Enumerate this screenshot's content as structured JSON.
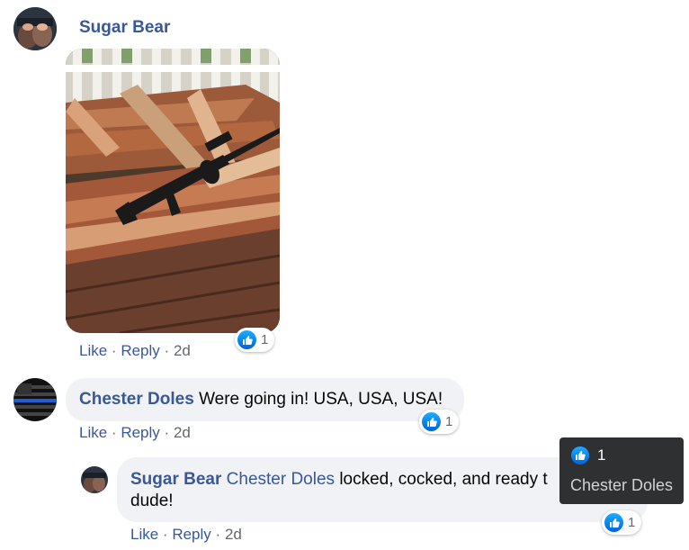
{
  "comments": [
    {
      "author": "Sugar Bear",
      "text": "",
      "has_photo": true,
      "actions": {
        "like": "Like",
        "reply": "Reply",
        "time": "2d",
        "sep": "·"
      },
      "reaction_count": "1"
    },
    {
      "author": "Chester Doles",
      "text": "Were going in! USA, USA, USA!",
      "actions": {
        "like": "Like",
        "reply": "Reply",
        "time": "2d",
        "sep": "·"
      },
      "reaction_count": "1"
    }
  ],
  "reply": {
    "author": "Sugar Bear",
    "mention": "Chester Doles",
    "text_line1": "locked, cocked, and ready t",
    "text_line2": "dude!",
    "actions": {
      "like": "Like",
      "reply": "Reply",
      "time": "2d",
      "sep": "·"
    },
    "reaction_count": "1"
  },
  "tooltip": {
    "count": "1",
    "name": "Chester Doles"
  },
  "icons": {
    "like": "thumbs-up-icon"
  },
  "colors": {
    "link": "#385898",
    "bubble": "#f0f2f5",
    "like_blue": "#1877f2"
  }
}
